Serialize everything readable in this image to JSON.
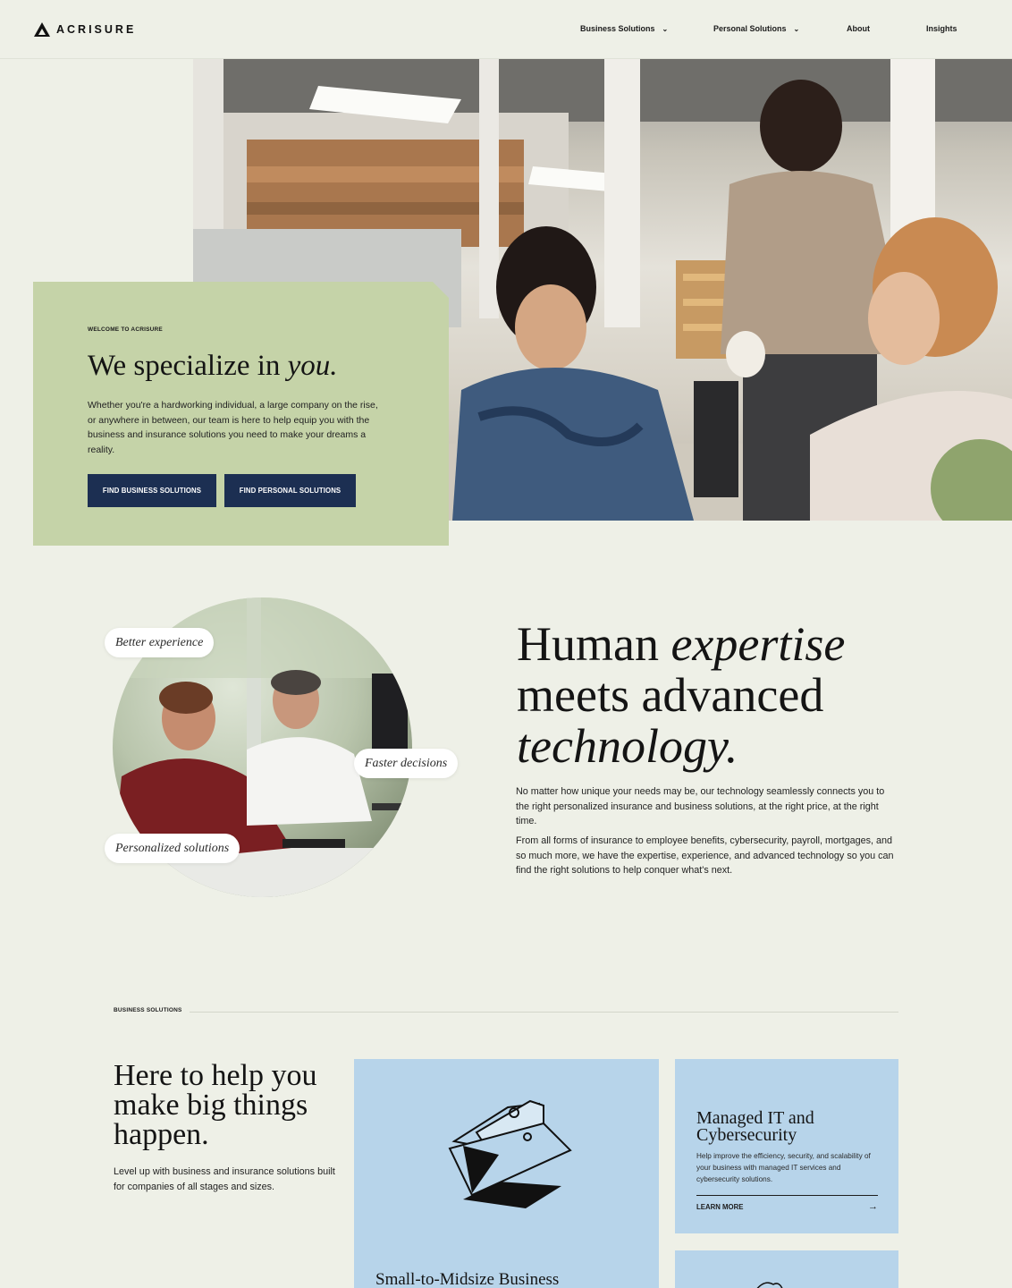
{
  "header": {
    "logo_text": "ACRISURE",
    "nav": [
      {
        "label": "Business Solutions",
        "has_dropdown": true
      },
      {
        "label": "Personal Solutions",
        "has_dropdown": true
      },
      {
        "label": "About",
        "has_dropdown": false
      },
      {
        "label": "Insights",
        "has_dropdown": false
      }
    ]
  },
  "hero": {
    "eyebrow": "WELCOME TO ACRISURE",
    "title_prefix": "We specialize in ",
    "title_emphasis": "you.",
    "body": "Whether you're a hardworking individual, a large company on the rise, or anywhere in between, our team is here to help equip you with the business and insurance solutions you need to make your dreams a reality.",
    "buttons": [
      "FIND BUSINESS SOLUTIONS",
      "FIND PERSONAL SOLUTIONS"
    ]
  },
  "expertise": {
    "pills": [
      "Better experience",
      "Faster decisions",
      "Personalized solutions"
    ],
    "title_line1_a": "Human ",
    "title_line1_b": "expertise",
    "title_line2": "meets advanced",
    "title_line3": "technology.",
    "paragraphs": [
      "No matter how unique your needs may be, our technology seamlessly connects you to the right personalized insurance and business solutions, at the right price, at the right time.",
      "From all forms of insurance to employee benefits, cybersecurity, payroll, mortgages, and so much more, we have the expertise, experience, and advanced technology so you can find the right solutions to help conquer what's next."
    ]
  },
  "business": {
    "label": "BUSINESS SOLUTIONS",
    "title": "Here to help you make big things happen.",
    "body": "Level up with business and insurance solutions built for companies of all stages and sizes.",
    "cards": [
      {
        "title": "Small-to-Midsize Business",
        "icon": "folder-icon"
      },
      {
        "title": "Managed IT and Cybersecurity",
        "body": "Help improve the efficiency, security, and scalability of your business with managed IT services and cybersecurity solutions.",
        "cta": "LEARN MORE"
      }
    ]
  },
  "colors": {
    "background": "#eef0e7",
    "hero_card": "#c5d3a8",
    "button": "#1c2f52",
    "card_blue": "#b7d4ea"
  }
}
